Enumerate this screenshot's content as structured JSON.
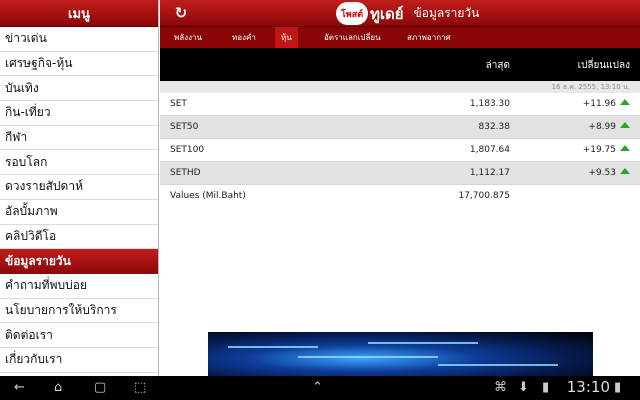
{
  "sidebar": {
    "header": "เมนู",
    "items": [
      "ข่าวเด่น",
      "เศรษฐกิจ-หุ้น",
      "บันเทิง",
      "กิน-เที่ยว",
      "กีฬา",
      "รอบโลก",
      "ดวงรายสัปดาห์",
      "อัลบั้มภาพ",
      "คลิปวิดีโอ"
    ],
    "section": "ข้อมูลรายวัน",
    "sub_items": [
      "คำถามที่พบบ่อย",
      "นโยบายการให้บริการ",
      "ติดต่อเรา",
      "เกี่ยวกับเรา"
    ]
  },
  "header": {
    "logo_badge": "โพสต์",
    "logo_word": "ทูเดย์",
    "title": "ข้อมูลรายวัน",
    "refresh_icon": "refresh-icon"
  },
  "tabs": [
    {
      "label": "พลังงาน",
      "active": false
    },
    {
      "label": "ทองคำ",
      "active": false
    },
    {
      "label": "หุ้น",
      "active": true
    },
    {
      "label": "อัตราแลกเปลี่ยน",
      "active": false
    },
    {
      "label": "สภาพอากาศ",
      "active": false
    }
  ],
  "table": {
    "col_latest": "ล่าสุด",
    "col_change": "เปลี่ยนแปลง",
    "date": "16 ธ.ค. 2555, 13:10 น.",
    "rows": [
      {
        "name": "SET",
        "latest": "1,183.30",
        "change": "+11.96",
        "trend": "up"
      },
      {
        "name": "SET50",
        "latest": "832.38",
        "change": "+8.99",
        "trend": "up"
      },
      {
        "name": "SET100",
        "latest": "1,807.64",
        "change": "+19.75",
        "trend": "up"
      },
      {
        "name": "SETHD",
        "latest": "1,112.17",
        "change": "+9.53",
        "trend": "up"
      }
    ],
    "values_label": "Values (Mil.Baht)",
    "values_amount": "17,700.875"
  },
  "colors": {
    "brand_red": "#b30f0f",
    "up_green": "#2aa52a"
  },
  "status_bar": {
    "time": "13:10"
  }
}
